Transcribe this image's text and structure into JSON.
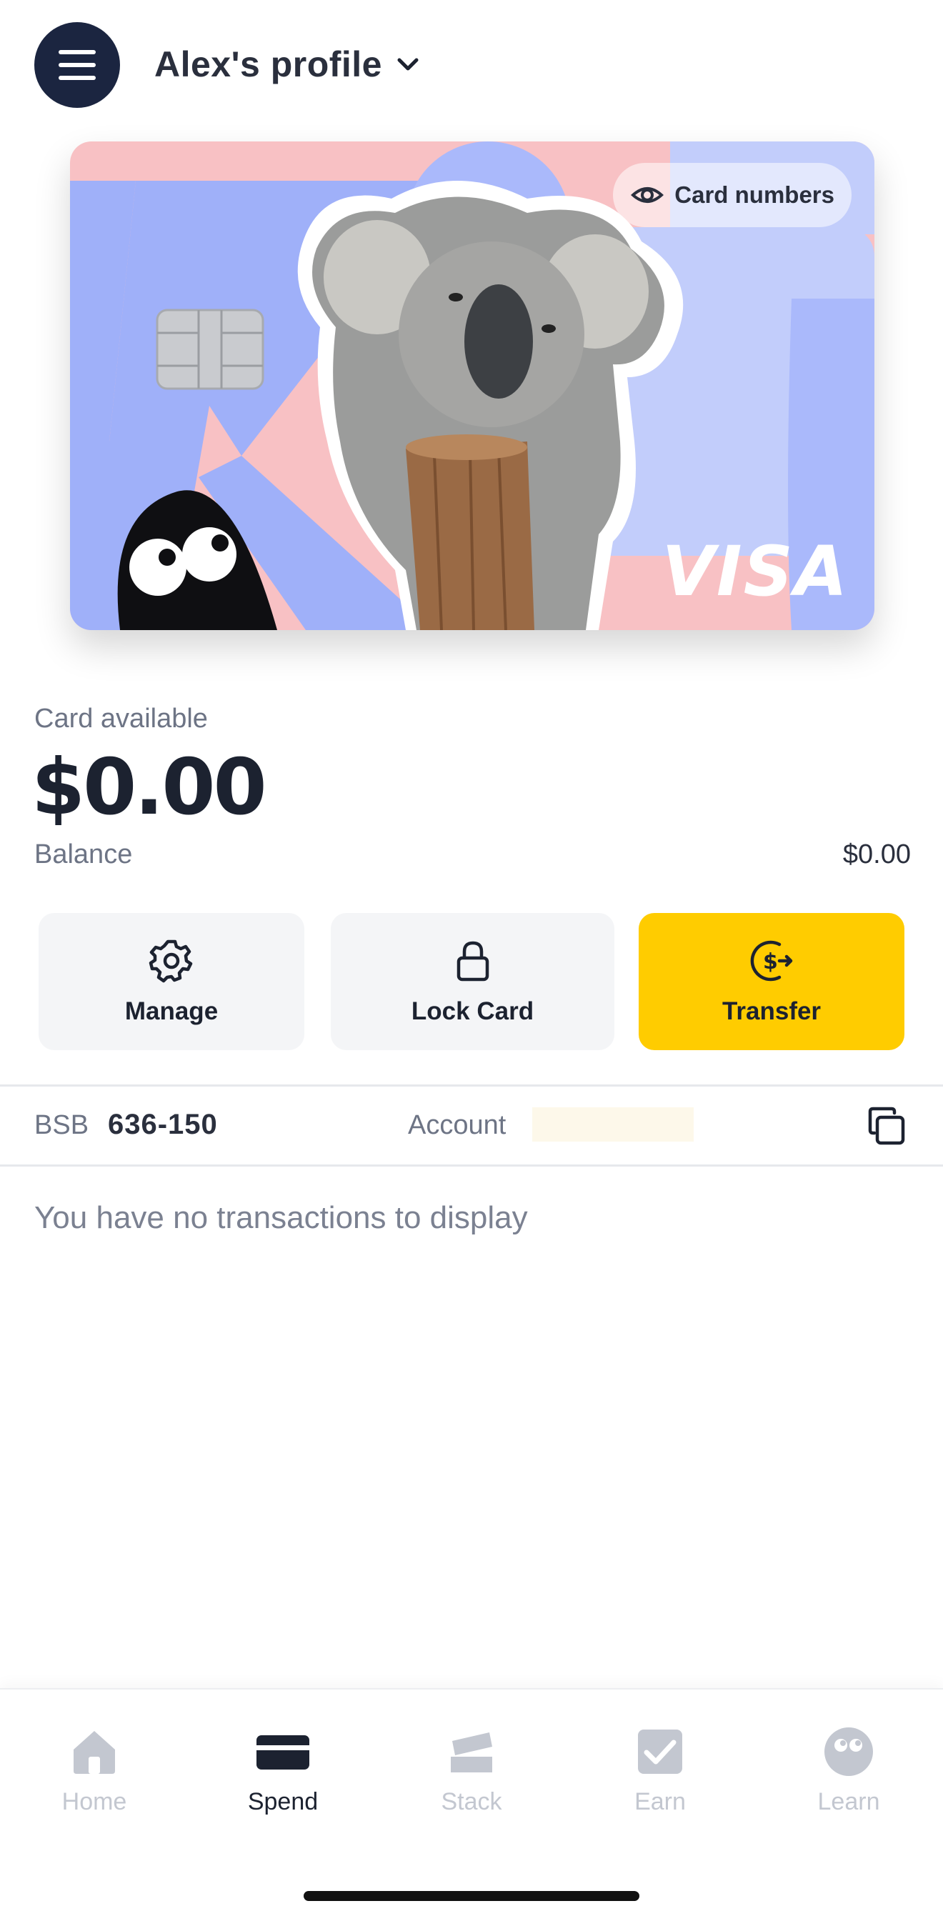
{
  "header": {
    "profile_name": "Alex's profile",
    "menu_icon": "hamburger-menu-icon",
    "dropdown_icon": "chevron-down-icon"
  },
  "card": {
    "reveal_label": "Card numbers",
    "reveal_icon": "eye-icon",
    "network": "VISA",
    "colors": {
      "pink": "#f8c1c4",
      "blue": "#9fb0f9",
      "light_blue": "#c2cdfb"
    }
  },
  "summary": {
    "available_label": "Card available",
    "available_amount": "$0.00",
    "balance_label": "Balance",
    "balance_value": "$0.00"
  },
  "actions": [
    {
      "label": "Manage",
      "icon": "gear-icon"
    },
    {
      "label": "Lock Card",
      "icon": "lock-icon"
    },
    {
      "label": "Transfer",
      "icon": "dollar-transfer-icon"
    }
  ],
  "account": {
    "bsb_label": "BSB",
    "bsb_value": "636-150",
    "account_label": "Account",
    "copy_icon": "copy-icon"
  },
  "transactions": {
    "empty_message": "You have no transactions to display"
  },
  "tabs": [
    {
      "label": "Home",
      "icon": "home-icon",
      "active": false
    },
    {
      "label": "Spend",
      "icon": "card-icon",
      "active": true
    },
    {
      "label": "Stack",
      "icon": "stack-icon",
      "active": false
    },
    {
      "label": "Earn",
      "icon": "checkbox-icon",
      "active": false
    },
    {
      "label": "Learn",
      "icon": "eyes-face-icon",
      "active": false
    }
  ],
  "colors": {
    "accent": "#ffcc00",
    "navy": "#1b2540",
    "muted_text": "#6d7485"
  }
}
